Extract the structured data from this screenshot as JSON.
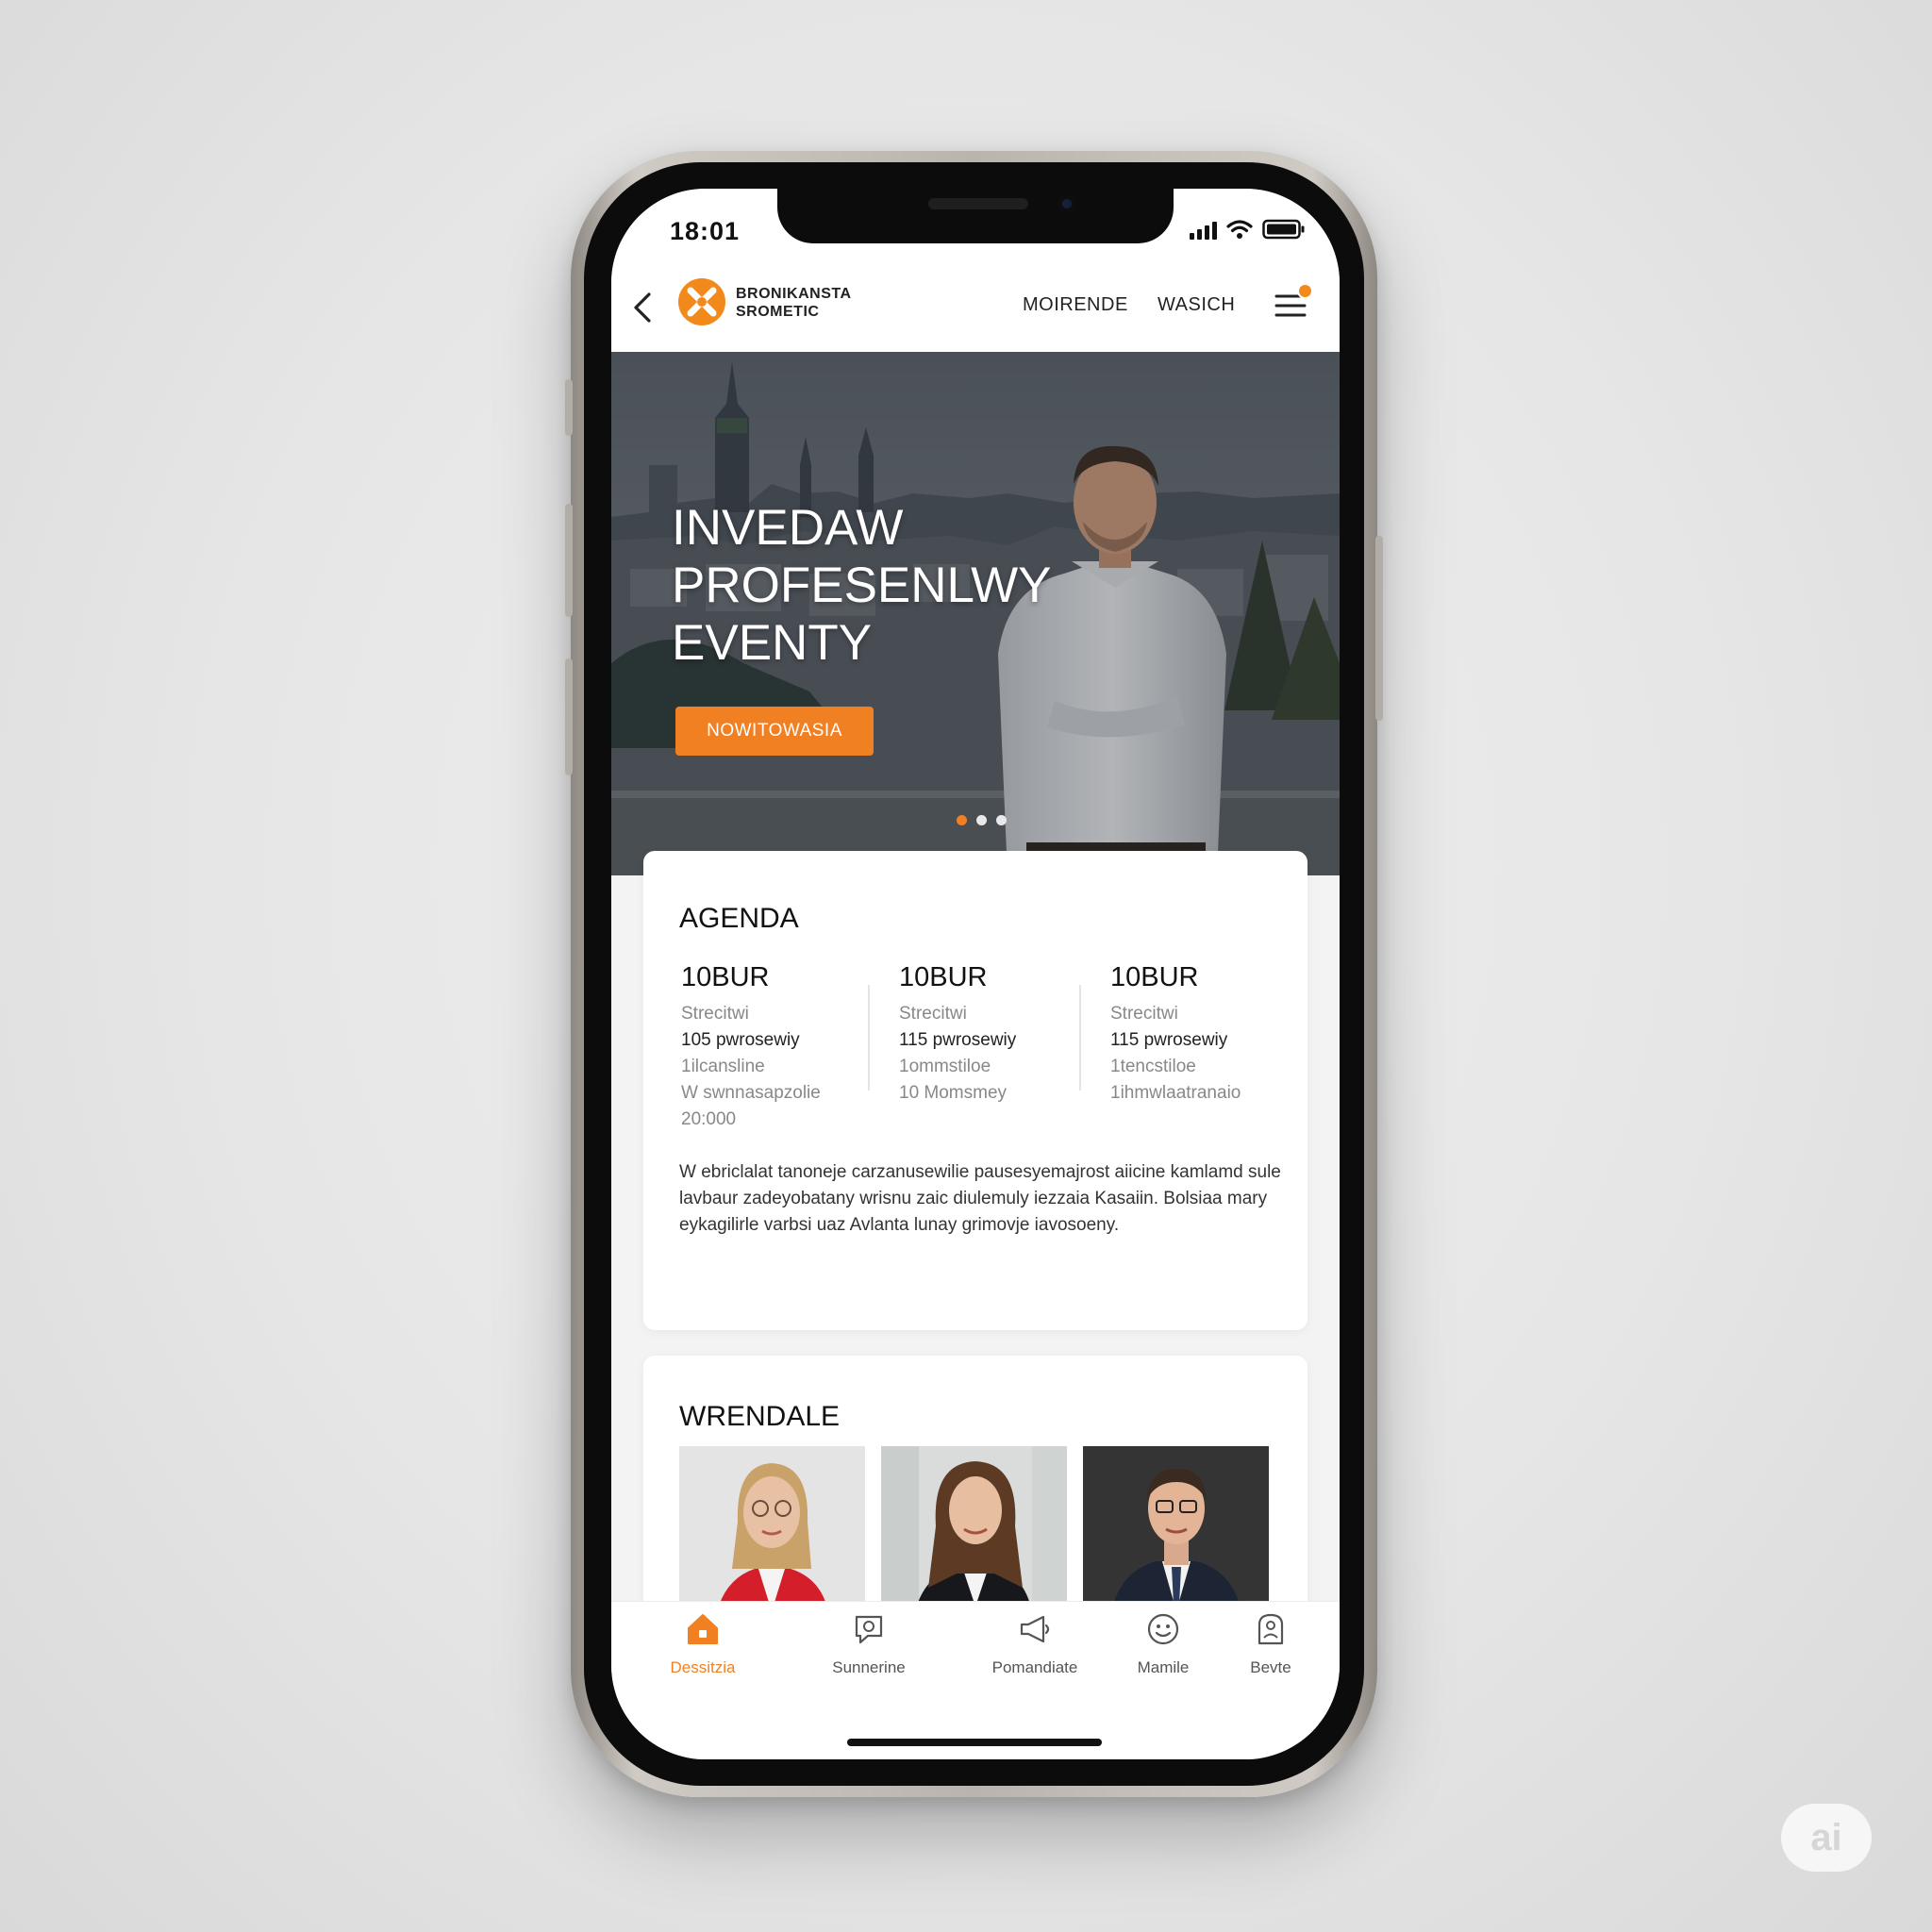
{
  "status_bar": {
    "time": "18:01",
    "icons": [
      "signal-icon",
      "wifi-icon",
      "battery-icon"
    ]
  },
  "header": {
    "brand_line1": "BRONIKANSTA",
    "brand_line2": "SROMETIC",
    "logo_icon": "x-logo-icon",
    "nav": [
      "MOIRENDE",
      "WASICH"
    ],
    "back_icon": "chevron-left-icon",
    "menu_icon": "hamburger-menu-icon",
    "menu_badge": "1"
  },
  "hero": {
    "title_lines": [
      "INVEDAW",
      "PROFESENLWY",
      "EVENTY"
    ],
    "cta_label": "NOWITOWASIA",
    "slides": [
      true,
      false,
      false
    ]
  },
  "agenda": {
    "title": "AGENDA",
    "columns": [
      {
        "time": "10BUR",
        "lines": [
          "Strecitwi",
          "105 pwrosewiy",
          "1ilcansline",
          "W swnnasapzolie",
          "20:000"
        ]
      },
      {
        "time": "10BUR",
        "lines": [
          "Strecitwi",
          "115 pwrosewiy",
          "1ommstiloe",
          "10 Momsmey"
        ]
      },
      {
        "time": "10BUR",
        "lines": [
          "Strecitwi",
          "115 pwrosewiy",
          "1tencstiloe",
          "1ihmwlaatranaio"
        ]
      }
    ],
    "description": "W ebriclalat tanoneje carzanusewilie pausesyemajrost aiicine kamlamd sule lavbaur zadeyobatany wrisnu zaic diulemuly iezzaia Kasaiin. Bolsiaa mary eykagilirle varbsi uaz Avlanta lunay grimovje iavosoeny."
  },
  "speakers": {
    "title": "WRENDALE",
    "people": [
      "speaker-1",
      "speaker-2",
      "speaker-3"
    ]
  },
  "bottom_nav": {
    "tabs": [
      {
        "label": "Dessitzia",
        "icon": "home-icon",
        "active": true
      },
      {
        "label": "Sunnerine",
        "icon": "chat-bubble-icon",
        "active": false
      },
      {
        "label": "Pomandiate",
        "icon": "megaphone-icon",
        "active": false
      },
      {
        "label": "Mamile",
        "icon": "smiley-icon",
        "active": false
      },
      {
        "label": "Bevte",
        "icon": "profile-icon",
        "active": false
      }
    ]
  },
  "watermark": "ai",
  "colors": {
    "accent": "#f08022",
    "text": "#111111",
    "hero_overlay": "#3e454c",
    "card": "#ffffff"
  }
}
